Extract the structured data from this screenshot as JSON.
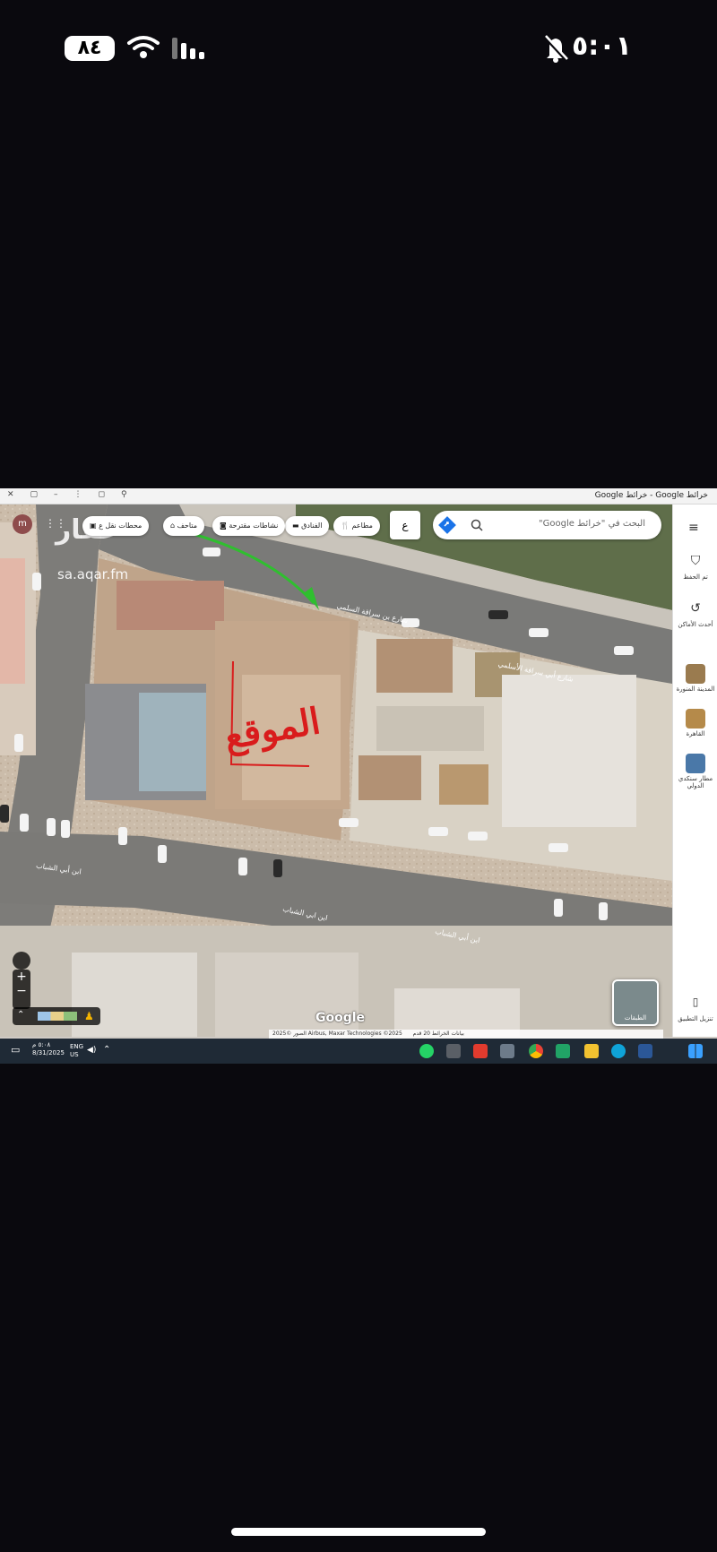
{
  "status_bar": {
    "battery": "٨٤",
    "time": "٥:٠١"
  },
  "browser": {
    "tab_title": "خرائط Google - خرائط Google"
  },
  "watermark": {
    "brand": "عقار",
    "site": "sa.aqar.fm"
  },
  "search": {
    "placeholder": "البحث في \"خرائط Google\""
  },
  "chips": [
    {
      "label": "مطاعم",
      "icon": "fork-knife-icon"
    },
    {
      "label": "الفنادق",
      "icon": "bed-icon"
    },
    {
      "label": "نشاطات مقترحة",
      "icon": "camera-icon"
    },
    {
      "label": "متاحف",
      "icon": "museum-icon"
    },
    {
      "label": "محطات نقل ع",
      "icon": "bus-icon"
    }
  ],
  "toolbar": {
    "more_button": "ع"
  },
  "profile": {
    "initial": "m"
  },
  "sidebar": {
    "items": [
      {
        "label": "تم الحفظ",
        "icon": "bookmark-icon"
      },
      {
        "label": "أحدث الأماكن",
        "icon": "history-icon"
      },
      {
        "label": "المدينة المنورة",
        "icon": "thumbnail"
      },
      {
        "label": "القاهرة",
        "icon": "thumbnail"
      },
      {
        "label": "مطار سنكدي الدولي",
        "icon": "thumbnail"
      },
      {
        "label": "تنزيل التطبيق",
        "icon": "phone-icon"
      }
    ]
  },
  "map": {
    "annotation": "الموقع",
    "street_labels": [
      "شارع بن سراقة السلمي",
      "شارع أبي سراقة الأسلمي",
      "ابن أبي الشباب",
      "ابن ابي الشباب",
      "ابن أبي الشباب"
    ],
    "layers_label": "الطبقات",
    "google_logo": "Google",
    "attribution": "الصور ©2025 Airbus, Maxar Technologies ©2025 بيانات الخرائط",
    "scale": "20 قدم"
  },
  "taskbar": {
    "time": "٥:٠٨ م",
    "date": "8/31/2025",
    "lang_top": "ENG",
    "lang_bottom": "US"
  },
  "colors": {
    "annotation_red": "#d91c1c",
    "arrow_green": "#2fbf2f",
    "taskbar": "#1f2a36"
  }
}
